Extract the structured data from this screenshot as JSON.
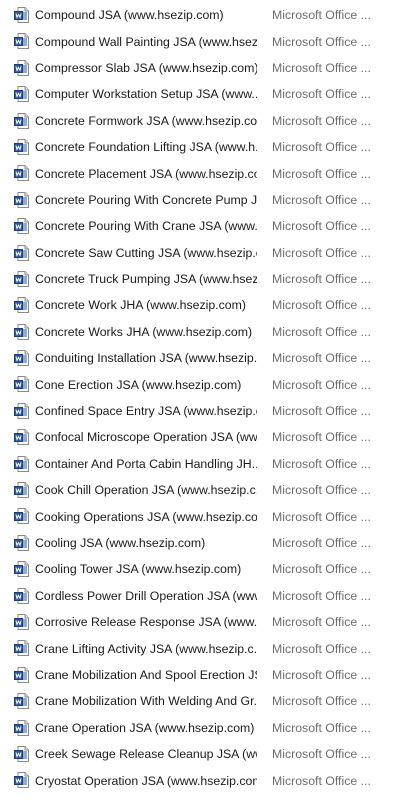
{
  "files": [
    {
      "name": "Compound JSA (www.hsezip.com)",
      "type": "Microsoft Office ..."
    },
    {
      "name": "Compound Wall Painting JSA (www.hsez...",
      "type": "Microsoft Office ..."
    },
    {
      "name": "Compressor Slab JSA (www.hsezip.com)",
      "type": "Microsoft Office ..."
    },
    {
      "name": "Computer Workstation Setup JSA (www....",
      "type": "Microsoft Office ..."
    },
    {
      "name": "Concrete Formwork JSA (www.hsezip.co...",
      "type": "Microsoft Office ..."
    },
    {
      "name": "Concrete Foundation Lifting JSA (www.h...",
      "type": "Microsoft Office ..."
    },
    {
      "name": "Concrete Placement JSA (www.hsezip.co...",
      "type": "Microsoft Office ..."
    },
    {
      "name": "Concrete Pouring With Concrete Pump J...",
      "type": "Microsoft Office ..."
    },
    {
      "name": "Concrete Pouring With Crane JSA (www....",
      "type": "Microsoft Office ..."
    },
    {
      "name": "Concrete Saw Cutting JSA (www.hsezip.c...",
      "type": "Microsoft Office ..."
    },
    {
      "name": "Concrete Truck Pumping JSA (www.hsezi...",
      "type": "Microsoft Office ..."
    },
    {
      "name": "Concrete Work JHA (www.hsezip.com)",
      "type": "Microsoft Office ..."
    },
    {
      "name": "Concrete Works JHA (www.hsezip.com)",
      "type": "Microsoft Office ..."
    },
    {
      "name": "Conduiting Installation JSA (www.hsezip...",
      "type": "Microsoft Office ..."
    },
    {
      "name": "Cone Erection JSA (www.hsezip.com)",
      "type": "Microsoft Office ..."
    },
    {
      "name": "Confined Space Entry JSA (www.hsezip.c...",
      "type": "Microsoft Office ..."
    },
    {
      "name": "Confocal Microscope Operation JSA (ww...",
      "type": "Microsoft Office ..."
    },
    {
      "name": "Container And Porta Cabin Handling JH...",
      "type": "Microsoft Office ..."
    },
    {
      "name": "Cook Chill Operation JSA (www.hsezip.c...",
      "type": "Microsoft Office ..."
    },
    {
      "name": "Cooking Operations JSA (www.hsezip.com)",
      "type": "Microsoft Office ..."
    },
    {
      "name": "Cooling JSA (www.hsezip.com)",
      "type": "Microsoft Office ..."
    },
    {
      "name": "Cooling Tower JSA (www.hsezip.com)",
      "type": "Microsoft Office ..."
    },
    {
      "name": "Cordless Power Drill Operation JSA (www...",
      "type": "Microsoft Office ..."
    },
    {
      "name": "Corrosive Release Response JSA (www.hs...",
      "type": "Microsoft Office ..."
    },
    {
      "name": "Crane Lifting Activity JSA (www.hsezip.c...",
      "type": "Microsoft Office ..."
    },
    {
      "name": "Crane Mobilization And Spool Erection JS...",
      "type": "Microsoft Office ..."
    },
    {
      "name": "Crane Mobilization With Welding And Gr...",
      "type": "Microsoft Office ..."
    },
    {
      "name": "Crane Operation JSA (www.hsezip.com)",
      "type": "Microsoft Office ..."
    },
    {
      "name": "Creek Sewage Release Cleanup JSA (www...",
      "type": "Microsoft Office ..."
    },
    {
      "name": "Cryostat Operation JSA (www.hsezip.com)",
      "type": "Microsoft Office ..."
    }
  ],
  "colors": {
    "word_icon_blue": "#2b579a",
    "word_icon_dark": "#1e3f73",
    "type_text": "#6d6d6d",
    "name_text": "#1a1a1a"
  },
  "icon": "word-document-icon"
}
